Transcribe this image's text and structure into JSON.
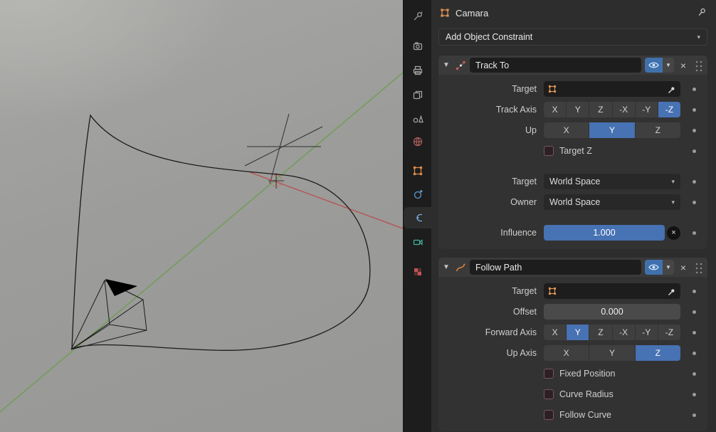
{
  "header": {
    "object_name": "Camara"
  },
  "add_constraint_button": "Add Object Constraint",
  "property_tabs": {
    "icons": [
      "tool",
      "render",
      "output",
      "view-layer",
      "scene",
      "world",
      "object",
      "physics",
      "constraints",
      "object-data",
      "texture"
    ],
    "active": "constraints"
  },
  "track_to": {
    "title": "Track To",
    "rows": {
      "target_label": "Target",
      "track_axis_label": "Track Axis",
      "up_label": "Up",
      "target_z_label": "Target Z",
      "target_space_label": "Target",
      "target_space_value": "World Space",
      "owner_space_label": "Owner",
      "owner_space_value": "World Space",
      "influence_label": "Influence",
      "influence_value": "1.000"
    },
    "axis_options": [
      "X",
      "Y",
      "Z",
      "-X",
      "-Y",
      "-Z"
    ],
    "up_options": [
      "X",
      "Y",
      "Z"
    ],
    "selected_axis": "-Z",
    "selected_up": "Y"
  },
  "follow_path": {
    "title": "Follow Path",
    "rows": {
      "target_label": "Target",
      "offset_label": "Offset",
      "offset_value": "0.000",
      "forward_axis_label": "Forward Axis",
      "up_axis_label": "Up Axis",
      "fixed_position_label": "Fixed Position",
      "curve_radius_label": "Curve Radius",
      "follow_curve_label": "Follow Curve"
    },
    "axis_options": [
      "X",
      "Y",
      "Z",
      "-X",
      "-Y",
      "-Z"
    ],
    "up_options": [
      "X",
      "Y",
      "Z"
    ],
    "selected_forward": "Y",
    "selected_up": "Z"
  },
  "colors": {
    "accent_blue": "#4772b3",
    "object_orange": "#e0944f"
  }
}
